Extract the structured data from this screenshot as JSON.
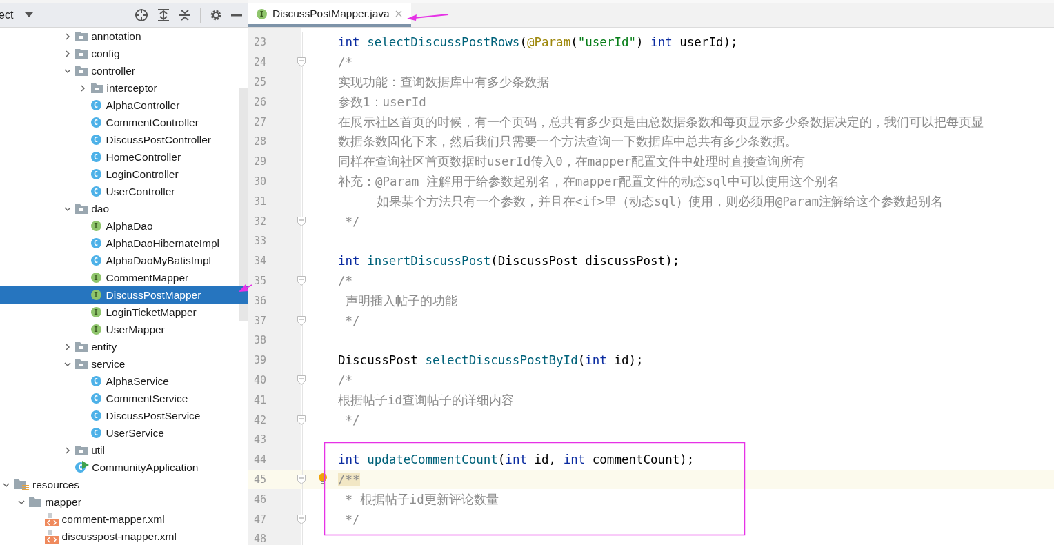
{
  "project_panel": {
    "title": "ect",
    "package_items": [
      {
        "kind": "folder",
        "label": "annotation",
        "expanded": false,
        "selected": false
      },
      {
        "kind": "folder",
        "label": "config",
        "expanded": false,
        "selected": false
      },
      {
        "kind": "folder",
        "label": "controller",
        "expanded": true,
        "selected": false,
        "children": [
          {
            "kind": "folder",
            "label": "interceptor",
            "expanded": false,
            "selected": false
          },
          {
            "kind": "class",
            "badge": "C",
            "label": "AlphaController",
            "selected": false
          },
          {
            "kind": "class",
            "badge": "C",
            "label": "CommentController",
            "selected": false
          },
          {
            "kind": "class",
            "badge": "C",
            "label": "DiscussPostController",
            "selected": false
          },
          {
            "kind": "class",
            "badge": "C",
            "label": "HomeController",
            "selected": false
          },
          {
            "kind": "class",
            "badge": "C",
            "label": "LoginController",
            "selected": false
          },
          {
            "kind": "class",
            "badge": "C",
            "label": "UserController",
            "selected": false
          }
        ]
      },
      {
        "kind": "folder",
        "label": "dao",
        "expanded": true,
        "selected": false,
        "children": [
          {
            "kind": "interface",
            "badge": "I",
            "label": "AlphaDao",
            "selected": false
          },
          {
            "kind": "class",
            "badge": "C",
            "label": "AlphaDaoHibernateImpl",
            "selected": false
          },
          {
            "kind": "class",
            "badge": "C",
            "label": "AlphaDaoMyBatisImpl",
            "selected": false
          },
          {
            "kind": "interface",
            "badge": "I",
            "label": "CommentMapper",
            "selected": false
          },
          {
            "kind": "interface",
            "badge": "I",
            "label": "DiscussPostMapper",
            "selected": true
          },
          {
            "kind": "interface",
            "badge": "I",
            "label": "LoginTicketMapper",
            "selected": false
          },
          {
            "kind": "interface",
            "badge": "I",
            "label": "UserMapper",
            "selected": false
          }
        ]
      },
      {
        "kind": "folder",
        "label": "entity",
        "expanded": false,
        "selected": false
      },
      {
        "kind": "folder",
        "label": "service",
        "expanded": true,
        "selected": false,
        "children": [
          {
            "kind": "class",
            "badge": "C",
            "label": "AlphaService",
            "selected": false
          },
          {
            "kind": "class",
            "badge": "C",
            "label": "CommentService",
            "selected": false
          },
          {
            "kind": "class",
            "badge": "C",
            "label": "DiscussPostService",
            "selected": false
          },
          {
            "kind": "class",
            "badge": "C",
            "label": "UserService",
            "selected": false
          }
        ]
      },
      {
        "kind": "folder",
        "label": "util",
        "expanded": false,
        "selected": false
      },
      {
        "kind": "app",
        "badge": "C",
        "label": "CommunityApplication",
        "selected": false
      }
    ],
    "resource_items": [
      {
        "kind": "resources",
        "label": "resources",
        "expanded": true,
        "selected": false,
        "children": [
          {
            "kind": "plain-folder",
            "label": "mapper",
            "expanded": true,
            "selected": false,
            "children": [
              {
                "kind": "xml",
                "label": "comment-mapper.xml",
                "selected": false
              },
              {
                "kind": "xml",
                "label": "discusspost-mapper.xml",
                "selected": false
              }
            ]
          }
        ]
      }
    ]
  },
  "editor": {
    "tabs": [
      {
        "badge": "I",
        "label": "DiscussPostMapper.java",
        "selected": true
      }
    ],
    "lines": [
      {
        "number": "23",
        "fold": false,
        "current": false,
        "tokens": [
          {
            "kind": "keyword",
            "text": "int "
          },
          {
            "kind": "method",
            "text": "selectDiscussPostRows"
          },
          {
            "kind": "plain",
            "text": "("
          },
          {
            "kind": "annotation",
            "text": "@Param"
          },
          {
            "kind": "plain",
            "text": "("
          },
          {
            "kind": "string",
            "text": "\"userId\""
          },
          {
            "kind": "plain",
            "text": ") "
          },
          {
            "kind": "keyword",
            "text": "int"
          },
          {
            "kind": "plain",
            "text": " userId);"
          }
        ]
      },
      {
        "number": "24",
        "fold": true,
        "current": false,
        "tokens": [
          {
            "kind": "comment",
            "text": "/*"
          }
        ]
      },
      {
        "number": "25",
        "fold": false,
        "current": false,
        "tokens": [
          {
            "kind": "comment",
            "text": "实现功能：查询数据库中有多少条数据"
          }
        ]
      },
      {
        "number": "26",
        "fold": false,
        "current": false,
        "tokens": [
          {
            "kind": "comment",
            "text": "参数1：userId"
          }
        ]
      },
      {
        "number": "27",
        "fold": false,
        "current": false,
        "tokens": [
          {
            "kind": "comment",
            "text": "在展示社区首页的时候，有一个页码，总共有多少页是由总数据条数和每页显示多少条数据决定的，我们可以把每页显"
          }
        ]
      },
      {
        "number": "28",
        "fold": false,
        "current": false,
        "tokens": [
          {
            "kind": "comment",
            "text": "数据条数固化下来，然后我们只需要一个方法查询一下数据库中总共有多少条数据。"
          }
        ]
      },
      {
        "number": "29",
        "fold": false,
        "current": false,
        "tokens": [
          {
            "kind": "comment",
            "text": "同样在查询社区首页数据时userId传入0，在mapper配置文件中处理时直接查询所有"
          }
        ]
      },
      {
        "number": "30",
        "fold": false,
        "current": false,
        "tokens": [
          {
            "kind": "comment",
            "text": "补充：@Param 注解用于给参数起别名，在mapper配置文件的动态sql中可以使用这个别名"
          }
        ]
      },
      {
        "number": "31",
        "fold": false,
        "current": false,
        "tokens": [
          {
            "kind": "comment-indented",
            "text": "如果某个方法只有一个参数，并且在<if>里（动态sql）使用，则必须用@Param注解给这个参数起别名"
          }
        ]
      },
      {
        "number": "32",
        "fold": true,
        "current": false,
        "tokens": [
          {
            "kind": "comment",
            "text": " */"
          }
        ]
      },
      {
        "number": "33",
        "fold": false,
        "current": false
      },
      {
        "number": "34",
        "fold": false,
        "current": false,
        "tokens": [
          {
            "kind": "keyword",
            "text": "int "
          },
          {
            "kind": "method",
            "text": "insertDiscussPost"
          },
          {
            "kind": "plain",
            "text": "(DiscussPost discussPost);"
          }
        ]
      },
      {
        "number": "35",
        "fold": true,
        "current": false,
        "tokens": [
          {
            "kind": "comment",
            "text": "/*"
          }
        ]
      },
      {
        "number": "36",
        "fold": false,
        "current": false,
        "tokens": [
          {
            "kind": "comment",
            "text": " 声明插入帖子的功能"
          }
        ]
      },
      {
        "number": "37",
        "fold": true,
        "current": false,
        "tokens": [
          {
            "kind": "comment",
            "text": " */"
          }
        ]
      },
      {
        "number": "38",
        "fold": false,
        "current": false
      },
      {
        "number": "39",
        "fold": false,
        "current": false,
        "tokens": [
          {
            "kind": "plain",
            "text": "DiscussPost "
          },
          {
            "kind": "method",
            "text": "selectDiscussPostById"
          },
          {
            "kind": "plain",
            "text": "("
          },
          {
            "kind": "keyword",
            "text": "int"
          },
          {
            "kind": "plain",
            "text": " id);"
          }
        ]
      },
      {
        "number": "40",
        "fold": true,
        "current": false,
        "tokens": [
          {
            "kind": "comment",
            "text": "/*"
          }
        ]
      },
      {
        "number": "41",
        "fold": false,
        "current": false,
        "tokens": [
          {
            "kind": "comment",
            "text": "根据帖子id查询帖子的详细内容"
          }
        ]
      },
      {
        "number": "42",
        "fold": true,
        "current": false,
        "tokens": [
          {
            "kind": "comment",
            "text": " */"
          }
        ]
      },
      {
        "number": "43",
        "fold": false,
        "current": false
      },
      {
        "number": "44",
        "fold": false,
        "current": false,
        "tokens": [
          {
            "kind": "keyword",
            "text": "int "
          },
          {
            "kind": "method",
            "text": "updateCommentCount"
          },
          {
            "kind": "plain",
            "text": "("
          },
          {
            "kind": "keyword",
            "text": "int"
          },
          {
            "kind": "plain",
            "text": " id, "
          },
          {
            "kind": "keyword",
            "text": "int"
          },
          {
            "kind": "plain",
            "text": " commentCount);"
          }
        ]
      },
      {
        "number": "45",
        "fold": true,
        "current": true,
        "bulb": true,
        "tokens": [
          {
            "kind": "comment-match",
            "text": "/**"
          }
        ]
      },
      {
        "number": "46",
        "fold": false,
        "current": false,
        "tokens": [
          {
            "kind": "comment",
            "text": " * 根据帖子id更新评论数量"
          }
        ]
      },
      {
        "number": "47",
        "fold": true,
        "current": false,
        "tokens": [
          {
            "kind": "comment",
            "text": " */"
          }
        ]
      },
      {
        "number": "48",
        "fold": false,
        "current": false
      }
    ]
  }
}
